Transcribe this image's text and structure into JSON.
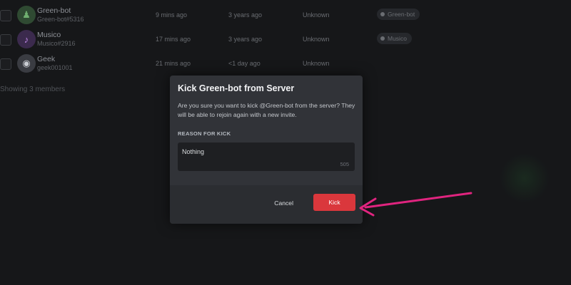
{
  "members": [
    {
      "name": "Green-bot",
      "tag": "Green-bot#5316",
      "joined_discord": "9 mins ago",
      "joined_server": "3 years ago",
      "invite": "Unknown",
      "role": "Green-bot",
      "avatar": "green-bot-icon",
      "avatar_glyph": "♟"
    },
    {
      "name": "Musico",
      "tag": "Musico#2916",
      "joined_discord": "17 mins ago",
      "joined_server": "3 years ago",
      "invite": "Unknown",
      "role": "Musico",
      "avatar": "music-note-icon",
      "avatar_glyph": "♪"
    },
    {
      "name": "Geek",
      "tag": "geek001001",
      "joined_discord": "21 mins ago",
      "joined_server": "<1 day ago",
      "invite": "Unknown",
      "role": "",
      "avatar": "discord-icon",
      "avatar_glyph": "◉"
    }
  ],
  "showing_text": "Showing 3 members",
  "modal": {
    "title": "Kick Green-bot from Server",
    "description": "Are you sure you want to kick @Green-bot from the server? They will be able to rejoin again with a new invite.",
    "reason_label": "REASON FOR KICK",
    "reason_value": "Nothing",
    "char_count": "505",
    "cancel_label": "Cancel",
    "kick_label": "Kick"
  },
  "colors": {
    "kick_button": "#da373c",
    "annotation_arrow": "#e0247f",
    "modal_bg": "#313338"
  }
}
